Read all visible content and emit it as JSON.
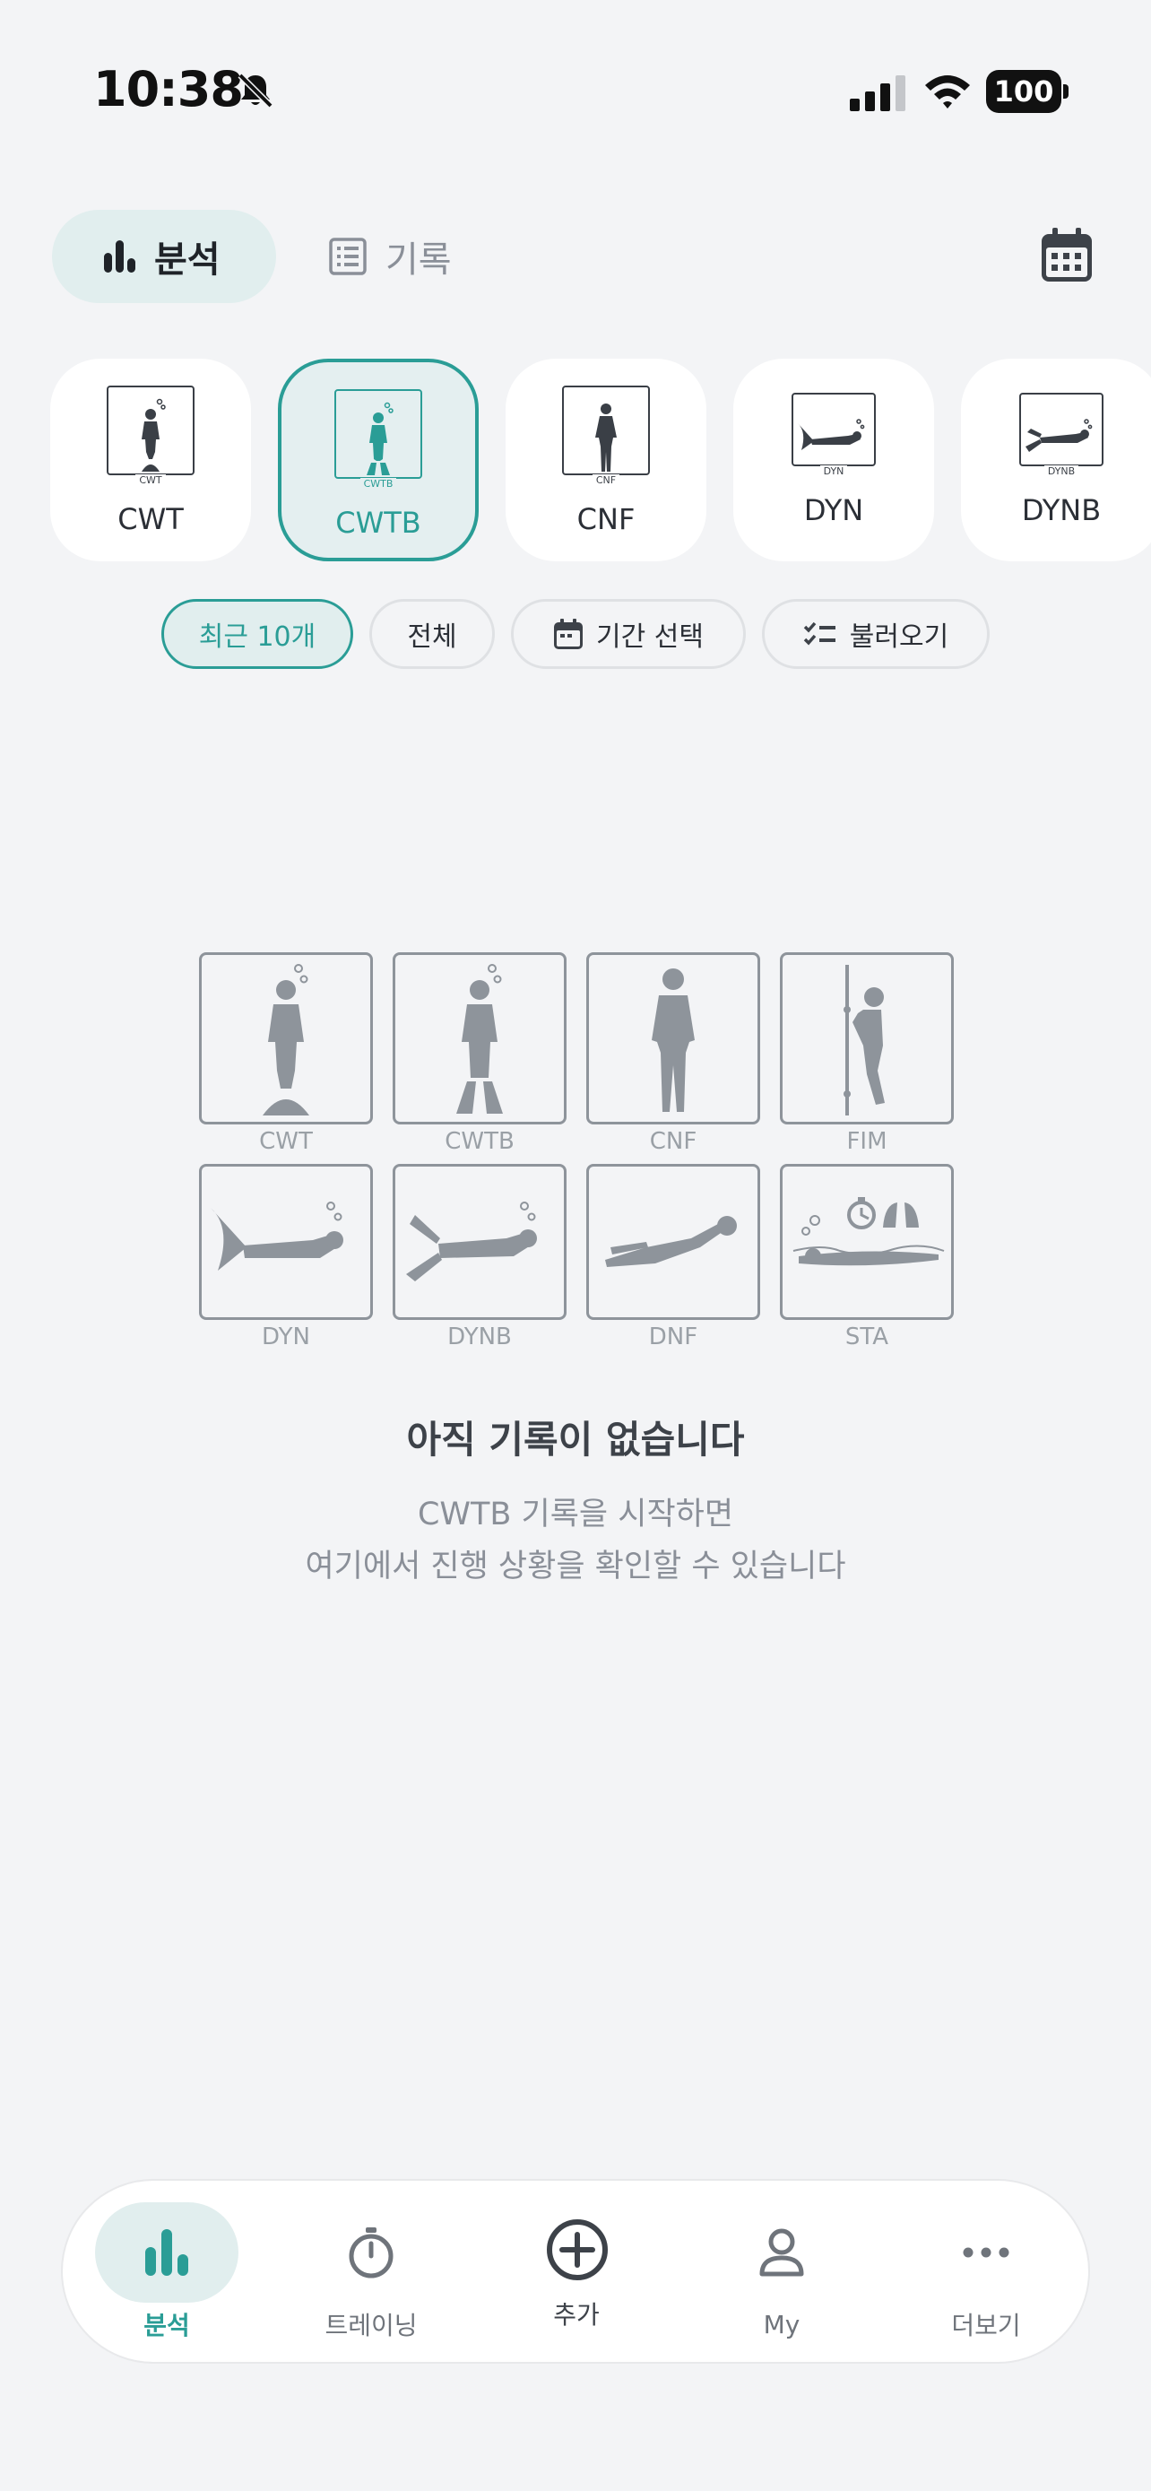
{
  "status_bar": {
    "time": "10:38",
    "battery": "100"
  },
  "view_switch": {
    "analysis_label": "분석",
    "record_label": "기록"
  },
  "disciplines": [
    {
      "code": "CWT",
      "label": "CWT",
      "selected": false
    },
    {
      "code": "CWTB",
      "label": "CWTB",
      "selected": true
    },
    {
      "code": "CNF",
      "label": "CNF",
      "selected": false
    },
    {
      "code": "DYN",
      "label": "DYN",
      "selected": false
    },
    {
      "code": "DYNB",
      "label": "DYNB",
      "selected": false
    }
  ],
  "filters": {
    "recent": "최근 10개",
    "all": "전체",
    "period": "기간 선택",
    "load": "불러오기"
  },
  "empty_state": {
    "grid": [
      "CWT",
      "CWTB",
      "CNF",
      "FIM",
      "DYN",
      "DYNB",
      "DNF",
      "STA"
    ],
    "title": "아직 기록이 없습니다",
    "line1": "CWTB 기록을 시작하면",
    "line2": "여기에서 진행 상황을 확인할 수 있습니다"
  },
  "bottom_nav": [
    {
      "label": "분석",
      "icon": "bar-chart-icon",
      "active": true
    },
    {
      "label": "트레이닝",
      "icon": "stopwatch-icon",
      "active": false
    },
    {
      "label": "추가",
      "icon": "plus-circle-icon",
      "active": false
    },
    {
      "label": "My",
      "icon": "person-icon",
      "active": false
    },
    {
      "label": "더보기",
      "icon": "more-dots-icon",
      "active": false
    }
  ],
  "colors": {
    "accent": "#2a9d96",
    "accent_bg": "#e1eeee",
    "background": "#f3f4f6",
    "icon_grey": "#8e949b"
  }
}
